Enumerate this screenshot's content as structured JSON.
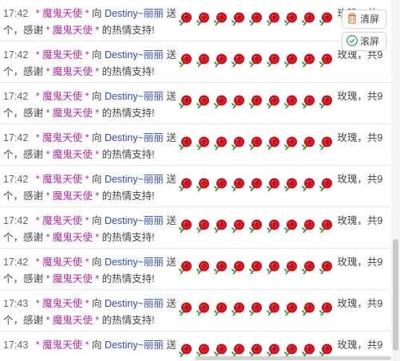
{
  "messages": [
    {
      "time": "17:42",
      "sender": "* 魔鬼天使 *",
      "to_word": "向",
      "host": "Destiny~丽丽",
      "send_word": "送",
      "rose_count": 9,
      "tail": "玫瑰，共9",
      "line2_pre": "个，感谢",
      "line2_user": "* 魔鬼天使 *",
      "line2_post": "的热情支持!"
    },
    {
      "time": "17:42",
      "sender": "* 魔鬼天使 *",
      "to_word": "向",
      "host": "Destiny~丽丽",
      "send_word": "送",
      "rose_count": 9,
      "tail": "玫瑰，共9",
      "line2_pre": "个，感谢",
      "line2_user": "* 魔鬼天使 *",
      "line2_post": "的热情支持!"
    },
    {
      "time": "17:42",
      "sender": "* 魔鬼天使 *",
      "to_word": "向",
      "host": "Destiny~丽丽",
      "send_word": "送",
      "rose_count": 9,
      "tail": "玫瑰，共9",
      "line2_pre": "个，感谢",
      "line2_user": "* 魔鬼天使 *",
      "line2_post": "的热情支持!"
    },
    {
      "time": "17:42",
      "sender": "* 魔鬼天使 *",
      "to_word": "向",
      "host": "Destiny~丽丽",
      "send_word": "送",
      "rose_count": 9,
      "tail": "玫瑰，共9",
      "line2_pre": "个，感谢",
      "line2_user": "* 魔鬼天使 *",
      "line2_post": "的热情支持!"
    },
    {
      "time": "17:42",
      "sender": "* 魔鬼天使 *",
      "to_word": "向",
      "host": "Destiny~丽丽",
      "send_word": "送",
      "rose_count": 9,
      "tail": "玫瑰，共9",
      "line2_pre": "个，感谢",
      "line2_user": "* 魔鬼天使 *",
      "line2_post": "的热情支持!"
    },
    {
      "time": "17:42",
      "sender": "* 魔鬼天使 *",
      "to_word": "向",
      "host": "Destiny~丽丽",
      "send_word": "送",
      "rose_count": 9,
      "tail": "玫瑰，共9",
      "line2_pre": "个，感谢",
      "line2_user": "* 魔鬼天使 *",
      "line2_post": "的热情支持!"
    },
    {
      "time": "17:42",
      "sender": "* 魔鬼天使 *",
      "to_word": "向",
      "host": "Destiny~丽丽",
      "send_word": "送",
      "rose_count": 9,
      "tail": "玫瑰，共9",
      "line2_pre": "个，感谢",
      "line2_user": "* 魔鬼天使 *",
      "line2_post": "的热情支持!"
    },
    {
      "time": "17:43",
      "sender": "* 魔鬼天使 *",
      "to_word": "向",
      "host": "Destiny~丽丽",
      "send_word": "送",
      "rose_count": 9,
      "tail": "玫瑰，共9",
      "line2_pre": "个，感谢",
      "line2_user": "* 魔鬼天使 *",
      "line2_post": "的热情支持!"
    },
    {
      "time": "17:43",
      "sender": "* 魔鬼天使 *",
      "to_word": "向",
      "host": "Destiny~丽丽",
      "send_word": "送",
      "rose_count": 9,
      "tail": "玫瑰，共9",
      "line2_pre": "",
      "line2_user": "",
      "line2_post": ""
    }
  ],
  "buttons": {
    "clear_label": "清屏",
    "scroll_label": "滚屏"
  },
  "colors": {
    "sender": "#b0289c",
    "host": "#2c49b8",
    "rose": "#d4121f",
    "clear_icon": "#e8733a",
    "scroll_icon": "#3aa84a"
  },
  "icons": {
    "rose": "rose-icon",
    "clear": "trash-icon",
    "scroll": "check-circle-icon"
  }
}
